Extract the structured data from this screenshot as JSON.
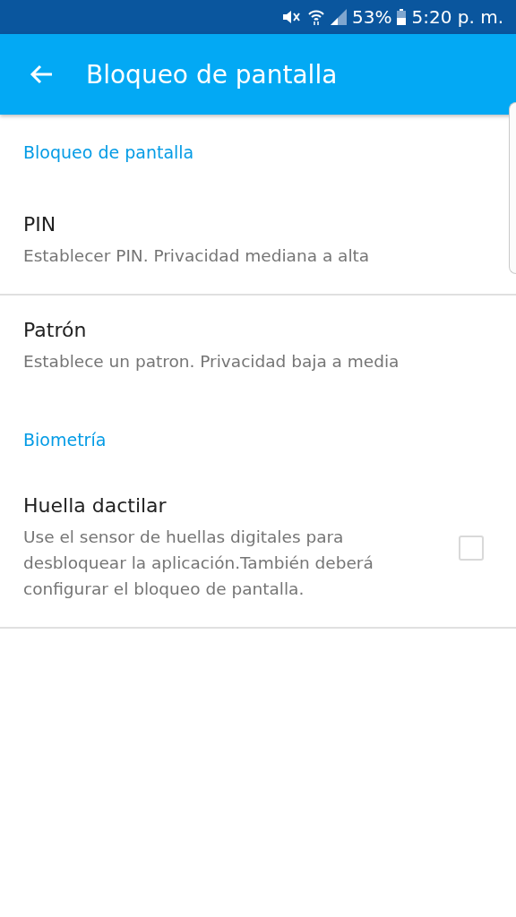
{
  "status_bar": {
    "battery": "53%",
    "time": "5:20 p. m."
  },
  "app_bar": {
    "title": "Bloqueo de pantalla"
  },
  "items": [
    {
      "kind": "category",
      "title": "Bloqueo de pantalla"
    },
    {
      "kind": "preference",
      "title": "PIN",
      "summary": "Establecer PIN. Privacidad mediana a alta",
      "divider": true
    },
    {
      "kind": "preference",
      "title": "Patrón",
      "summary": "Establece un patron. Privacidad baja a media",
      "divider": false
    },
    {
      "kind": "category",
      "title": "Biometría"
    },
    {
      "kind": "checkbox",
      "title": "Huella dactilar",
      "summary": "Use el sensor de huellas digitales para desbloquear la aplicación.También deberá configurar el bloqueo de pantalla.",
      "checked": false,
      "divider": true
    }
  ]
}
